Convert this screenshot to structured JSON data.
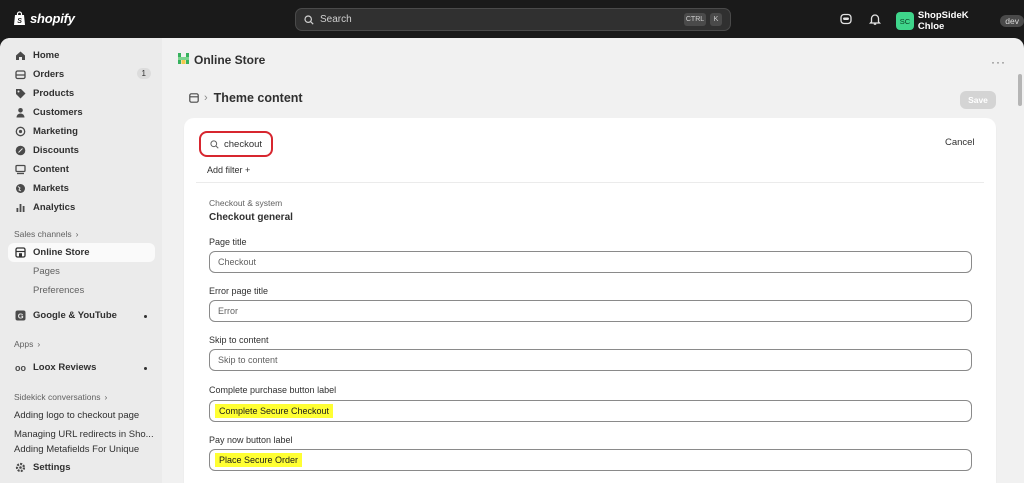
{
  "topbar": {
    "brand": "shopify",
    "search_placeholder": "Search",
    "kbd_ctrl": "CTRL",
    "kbd_k": "K",
    "user_initials": "SC",
    "user_name": "ShopSideK Chloe",
    "user_badge": "dev"
  },
  "sidebar": {
    "home": "Home",
    "orders": "Orders",
    "orders_count": "1",
    "products": "Products",
    "customers": "Customers",
    "marketing": "Marketing",
    "discounts": "Discounts",
    "content": "Content",
    "markets": "Markets",
    "analytics": "Analytics",
    "sales_channels": "Sales channels",
    "online_store": "Online Store",
    "pages": "Pages",
    "preferences": "Preferences",
    "google_youtube": "Google & YouTube",
    "apps": "Apps",
    "loox_reviews": "Loox Reviews",
    "sidekick_conversations": "Sidekick conversations",
    "conv1": "Adding logo to checkout page",
    "conv2": "Managing URL redirects in Sho...",
    "conv3": "Adding Metafields For Unique",
    "settings": "Settings"
  },
  "main": {
    "store_title": "Online Store",
    "more": "···",
    "breadcrumb": "Theme content",
    "save_label": "Save",
    "search_value": "checkout",
    "cancel_label": "Cancel",
    "add_filter": "Add filter +",
    "group_label": "Checkout & system",
    "group_title": "Checkout general",
    "fields": [
      {
        "label": "Page title",
        "value": "Checkout"
      },
      {
        "label": "Error page title",
        "value": "Error"
      },
      {
        "label": "Skip to content",
        "value": "Skip to content"
      },
      {
        "label": "Complete purchase button label",
        "value": "Complete Secure Checkout"
      },
      {
        "label": "Pay now button label",
        "value": "Place Secure Order"
      }
    ]
  },
  "colors": {
    "highlight": "#ffff33",
    "focus_ring": "#d7262f",
    "avatar": "#3fd58b"
  }
}
